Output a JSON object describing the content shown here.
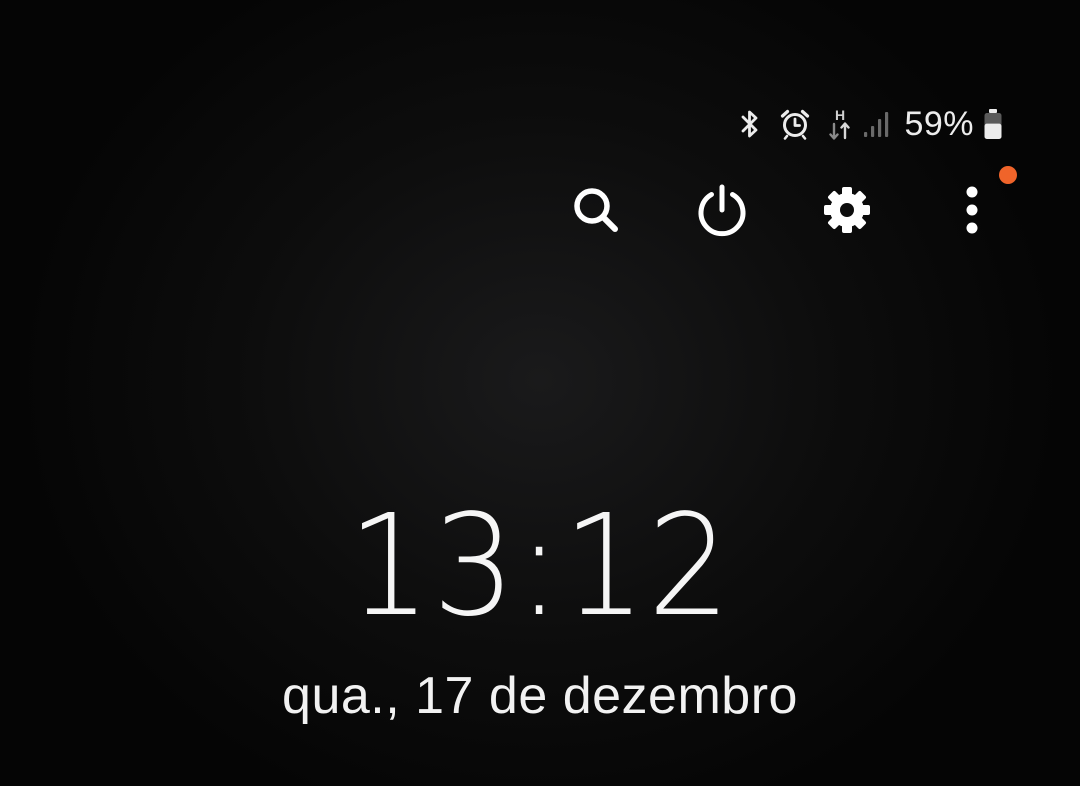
{
  "status_bar": {
    "icons": [
      "bluetooth-icon",
      "alarm-icon",
      "hspa-data-icon",
      "signal-icon",
      "battery-icon"
    ],
    "network_type": "H",
    "battery_percent": "59%",
    "battery_level": 0.59
  },
  "quick_actions": {
    "buttons": [
      "search-icon",
      "power-icon",
      "gear-icon",
      "more-vertical-icon"
    ],
    "has_notification": true,
    "notification_color": "#f0642a"
  },
  "lock_screen": {
    "time": "13:12",
    "date": "qua., 17 de dezembro"
  },
  "colors": {
    "background": "#0d0d0d",
    "foreground": "#ffffff",
    "accent": "#f0642a"
  }
}
